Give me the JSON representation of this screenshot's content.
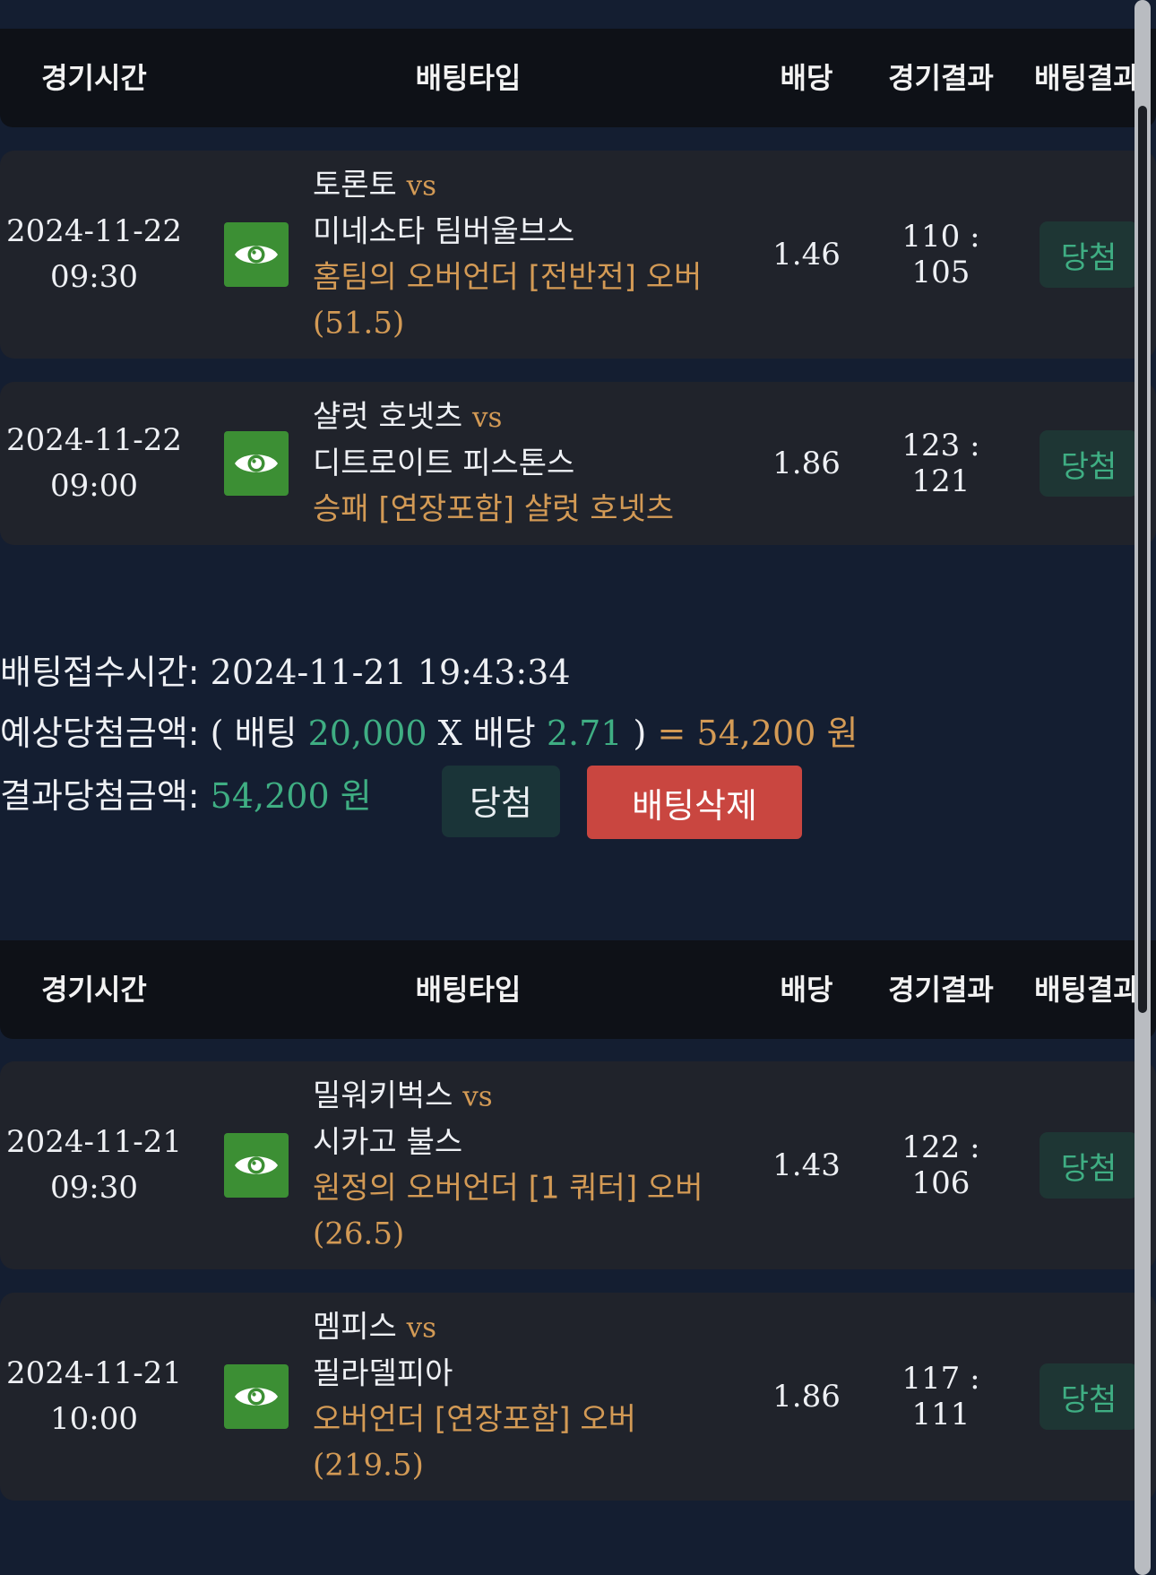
{
  "table_headers": {
    "time": "경기시간",
    "type": "배팅타입",
    "odds": "배당",
    "game_result": "경기결과",
    "bet_result": "배팅결과"
  },
  "group1": {
    "rows": [
      {
        "date": "2024-11-22",
        "time": "09:30",
        "home": "토론토",
        "vs": "vs",
        "away": "미네소타 팀버울브스",
        "pick_ko": "홈팀의 오버언더 [전반전] 오버",
        "pick_val": "(51.5)",
        "odds": "1.46",
        "score": "110 : 105",
        "result": "당첨",
        "icon": "eye-icon"
      },
      {
        "date": "2024-11-22",
        "time": "09:00",
        "home": "샬럿 호넷츠",
        "vs": "vs",
        "away": "디트로이트 피스톤스",
        "pick_ko": "승패 [연장포함] 샬럿 호넷츠",
        "pick_val": "",
        "odds": "1.86",
        "score": "123 : 121",
        "result": "당첨",
        "icon": "eye-icon"
      }
    ]
  },
  "summary": {
    "received_label": "배팅접수시간:",
    "received_value": "2024-11-21 19:43:34",
    "expected_label": "예상당첨금액:",
    "paren_open": "(",
    "bet_label": "배팅",
    "bet_amount": "20,000",
    "x_sign": "X",
    "odds_label": "배당",
    "total_odds": "2.71",
    "paren_close": ")",
    "equals": "=",
    "expected_amount": "54,200 원",
    "actual_label": "결과당첨금액:",
    "actual_amount": "54,200 원",
    "status_button": "당첨",
    "delete_button": "배팅삭제"
  },
  "group2": {
    "rows": [
      {
        "date": "2024-11-21",
        "time": "09:30",
        "home": "밀워키벅스",
        "vs": "vs",
        "away": "시카고 불스",
        "pick_ko": "원정의 오버언더 [1 쿼터] 오버",
        "pick_val": "(26.5)",
        "odds": "1.43",
        "score": "122 : 106",
        "result": "당첨",
        "icon": "eye-icon"
      },
      {
        "date": "2024-11-21",
        "time": "10:00",
        "home": "멤피스",
        "vs": "vs",
        "away": "필라델피아",
        "pick_ko": "오버언더 [연장포함] 오버",
        "pick_val": "(219.5)",
        "odds": "1.86",
        "score": "117 : 111",
        "result": "당첨",
        "icon": "eye-icon"
      }
    ]
  },
  "colors": {
    "background": "#141e31",
    "header_bg": "#0e1117",
    "row_bg": "#20232b",
    "accent_orange": "#d39a55",
    "accent_green": "#3fae83",
    "eye_green": "#3c8f34",
    "delete_red": "#c94640"
  }
}
